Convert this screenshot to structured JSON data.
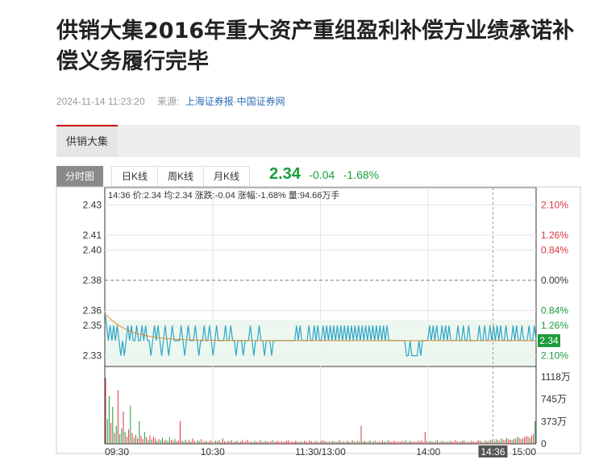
{
  "article": {
    "title": "供销大集2016年重大资产重组盈利补偿方业绩承诺补偿义务履行完毕",
    "datetime": "2024-11-14 11:23:20",
    "source_label": "来源:",
    "source": "上海证券报·中国证券网"
  },
  "stock": {
    "name": "供销大集",
    "tabs": [
      {
        "label": "分时图",
        "active": true
      },
      {
        "label": "日K线",
        "active": false
      },
      {
        "label": "周K线",
        "active": false
      },
      {
        "label": "月K线",
        "active": false
      }
    ],
    "price": "2.34",
    "change": "-0.04",
    "change_pct": "-1.68%"
  },
  "colors": {
    "down": "#1a9c3a",
    "up": "#d9363e",
    "price_line": "#2aa6c8",
    "avg_line": "#e08a2a",
    "fill": "#e8f5ec"
  },
  "chart_data": {
    "type": "line",
    "info_bar": "14:36 价:2.34 均:2.34 涨跌:-0.04 涨幅:-1.68% 量:94.66万手",
    "prev_close": 2.38,
    "y_ticks": [
      "2.43",
      "2.41",
      "2.40",
      "2.38",
      "2.36",
      "2.35",
      "2.33"
    ],
    "y_tick_values": [
      2.43,
      2.41,
      2.4,
      2.38,
      2.36,
      2.35,
      2.33
    ],
    "pct_ticks": [
      "2.10%",
      "1.26%",
      "0.84%",
      "0.00%",
      "0.84%",
      "1.26%",
      "2.10%"
    ],
    "vol_ticks": [
      "1118万",
      "745万",
      "373万",
      "0"
    ],
    "vol_tick_values": [
      1118,
      745,
      373,
      0
    ],
    "x_ticks": [
      "09:30",
      "10:30",
      "11:30/13:00",
      "14:00",
      "15:00"
    ],
    "x_tick_minutes": [
      0,
      60,
      120,
      180,
      240
    ],
    "cursor_label": "14:36",
    "cursor_minute": 216,
    "last_price_label": "2.34",
    "ylim": [
      2.325,
      2.435
    ],
    "vol_max": 1118,
    "price_series": [
      2.36,
      2.35,
      2.34,
      2.35,
      2.34,
      2.35,
      2.34,
      2.35,
      2.34,
      2.33,
      2.34,
      2.33,
      2.34,
      2.35,
      2.34,
      2.35,
      2.34,
      2.34,
      2.35,
      2.34,
      2.34,
      2.35,
      2.34,
      2.35,
      2.34,
      2.34,
      2.33,
      2.34,
      2.35,
      2.34,
      2.35,
      2.34,
      2.33,
      2.34,
      2.35,
      2.34,
      2.33,
      2.34,
      2.35,
      2.34,
      2.34,
      2.34,
      2.34,
      2.35,
      2.34,
      2.33,
      2.34,
      2.35,
      2.34,
      2.34,
      2.34,
      2.35,
      2.34,
      2.33,
      2.34,
      2.34,
      2.35,
      2.34,
      2.34,
      2.35,
      2.34,
      2.33,
      2.34,
      2.35,
      2.34,
      2.34,
      2.34,
      2.34,
      2.35,
      2.34,
      2.34,
      2.35,
      2.34,
      2.34,
      2.33,
      2.34,
      2.34,
      2.34,
      2.33,
      2.34,
      2.34,
      2.34,
      2.35,
      2.34,
      2.33,
      2.34,
      2.34,
      2.35,
      2.34,
      2.34,
      2.33,
      2.34,
      2.34,
      2.34,
      2.33,
      2.34,
      2.34,
      2.34,
      2.34,
      2.34,
      2.34,
      2.34,
      2.34,
      2.34,
      2.34,
      2.34,
      2.34,
      2.34,
      2.35,
      2.34,
      2.35,
      2.34,
      2.34,
      2.34,
      2.34,
      2.35,
      2.34,
      2.34,
      2.35,
      2.34,
      2.35,
      2.34,
      2.34,
      2.35,
      2.34,
      2.35,
      2.34,
      2.35,
      2.34,
      2.35,
      2.34,
      2.35,
      2.34,
      2.35,
      2.34,
      2.35,
      2.34,
      2.35,
      2.34,
      2.35,
      2.34,
      2.35,
      2.34,
      2.35,
      2.34,
      2.35,
      2.34,
      2.35,
      2.34,
      2.35,
      2.34,
      2.35,
      2.34,
      2.35,
      2.34,
      2.35,
      2.34,
      2.35,
      2.34,
      2.35,
      2.34,
      2.34,
      2.34,
      2.34,
      2.34,
      2.34,
      2.34,
      2.34,
      2.34,
      2.34,
      2.33,
      2.33,
      2.34,
      2.33,
      2.33,
      2.33,
      2.33,
      2.34,
      2.33,
      2.34,
      2.34,
      2.34,
      2.34,
      2.35,
      2.34,
      2.35,
      2.34,
      2.35,
      2.34,
      2.34,
      2.35,
      2.34,
      2.35,
      2.34,
      2.35,
      2.34,
      2.34,
      2.34,
      2.34,
      2.35,
      2.34,
      2.34,
      2.35,
      2.34,
      2.34,
      2.35,
      2.34,
      2.34,
      2.34,
      2.34,
      2.34,
      2.35,
      2.34,
      2.34,
      2.35,
      2.34,
      2.34,
      2.35,
      2.34,
      2.35,
      2.34,
      2.35,
      2.34,
      2.35,
      2.34,
      2.34,
      2.35,
      2.34,
      2.34,
      2.34,
      2.35,
      2.34,
      2.35,
      2.34,
      2.34,
      2.35,
      2.34,
      2.34,
      2.34,
      2.35,
      2.34,
      2.34,
      2.35,
      2.34
    ],
    "avg_series_start": 2.358,
    "avg_series_end": 2.34,
    "volume_series": [
      1100,
      420,
      800,
      350,
      620,
      180,
      300,
      900,
      160,
      260,
      540,
      200,
      120,
      240,
      640,
      180,
      100,
      150,
      90,
      380,
      130,
      80,
      200,
      110,
      60,
      140,
      70,
      120,
      90,
      50,
      80,
      60,
      100,
      50,
      70,
      40,
      110,
      60,
      50,
      80,
      40,
      60,
      380,
      50,
      40,
      70,
      30,
      60,
      40,
      90,
      50,
      30,
      60,
      40,
      80,
      30,
      50,
      40,
      30,
      60,
      40,
      30,
      50,
      40,
      60,
      30,
      90,
      40,
      30,
      50,
      40,
      60,
      30,
      40,
      50,
      30,
      40,
      60,
      30,
      40,
      70,
      30,
      40,
      30,
      50,
      40,
      30,
      60,
      40,
      30,
      50,
      40,
      30,
      40,
      60,
      30,
      40,
      50,
      30,
      40,
      30,
      40,
      50,
      60,
      30,
      40,
      30,
      50,
      40,
      30,
      40,
      30,
      50,
      40,
      30,
      60,
      40,
      30,
      40,
      50,
      30,
      40,
      60,
      50,
      40,
      30,
      40,
      30,
      50,
      40,
      30,
      40,
      60,
      30,
      40,
      30,
      50,
      40,
      30,
      60,
      40,
      30,
      50,
      40,
      300,
      40,
      50,
      30,
      40,
      60,
      30,
      40,
      50,
      30,
      40,
      30,
      50,
      40,
      30,
      60,
      40,
      30,
      40,
      50,
      30,
      40,
      30,
      50,
      40,
      60,
      30,
      40,
      50,
      30,
      40,
      30,
      50,
      40,
      60,
      30,
      200,
      40,
      30,
      50,
      40,
      30,
      40,
      60,
      30,
      40,
      50,
      30,
      40,
      30,
      50,
      40,
      30,
      60,
      40,
      30,
      40,
      50,
      60,
      30,
      40,
      30,
      50,
      40,
      30,
      40,
      60,
      50,
      40,
      30,
      60,
      40,
      50,
      70,
      60,
      40,
      80,
      60,
      50,
      90,
      70,
      60,
      100,
      80,
      70,
      60,
      90,
      80,
      120,
      100,
      80,
      90,
      110,
      130,
      120,
      100,
      140,
      160,
      380
    ]
  }
}
